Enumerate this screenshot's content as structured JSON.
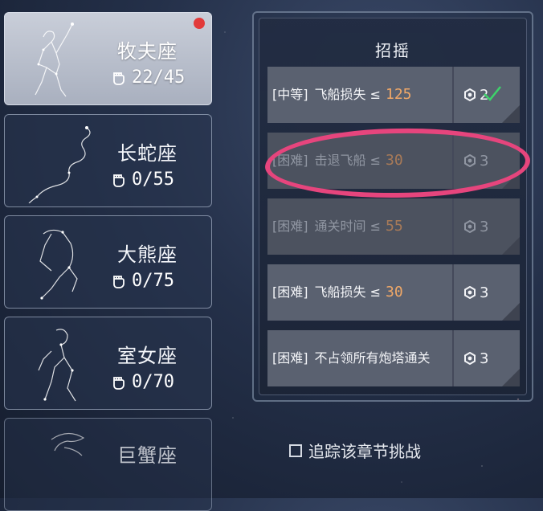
{
  "constellations": [
    {
      "name": "牧夫座",
      "progress": "22/45",
      "selected": true,
      "has_notification": true
    },
    {
      "name": "长蛇座",
      "progress": "0/55",
      "selected": false
    },
    {
      "name": "大熊座",
      "progress": "0/75",
      "selected": false
    },
    {
      "name": "室女座",
      "progress": "0/70",
      "selected": false
    },
    {
      "name": "巨蟹座",
      "progress": "",
      "selected": false
    }
  ],
  "panel": {
    "title": "招摇",
    "challenges": [
      {
        "difficulty": "[中等]",
        "text": "飞船损失 ≤",
        "value": "125",
        "reward": "2",
        "completed": true,
        "dim": false
      },
      {
        "difficulty": "[困难]",
        "text": "击退飞船 ≤",
        "value": "30",
        "reward": "3",
        "completed": false,
        "dim": true
      },
      {
        "difficulty": "[困难]",
        "text": "通关时间 ≤",
        "value": "55",
        "reward": "3",
        "completed": false,
        "dim": true
      },
      {
        "difficulty": "[困难]",
        "text": "飞船损失 ≤",
        "value": "30",
        "reward": "3",
        "completed": false,
        "dim": false
      },
      {
        "difficulty": "[困难]",
        "text": "不占领所有炮塔通关",
        "value": "",
        "reward": "3",
        "completed": false,
        "dim": false
      }
    ]
  },
  "track": {
    "label": "追踪该章节挑战",
    "checked": false
  },
  "colors": {
    "accent_value": "#f0a868",
    "annotation": "#e6457d",
    "check": "#3dd36a",
    "notification": "#e23a3a"
  }
}
